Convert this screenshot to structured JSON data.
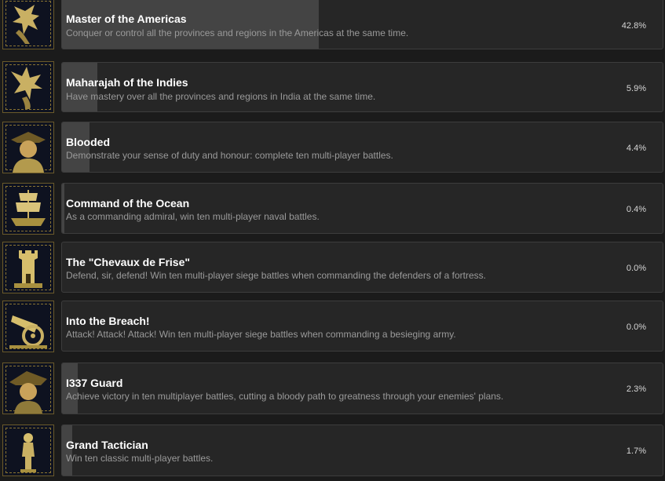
{
  "achievements": [
    {
      "title": "Master of the Americas",
      "description": "Conquer or control all the provinces and regions in the Americas at the same time.",
      "percent_text": "42.8%",
      "percent": 42.8,
      "icon": "eagle-icon"
    },
    {
      "title": "Maharajah of the Indies",
      "description": "Have mastery over all the provinces and regions in India at the same time.",
      "percent_text": "5.9%",
      "percent": 5.9,
      "icon": "eagle-icon"
    },
    {
      "title": "Blooded",
      "description": "Demonstrate your sense of duty and honour: complete ten multi-player battles.",
      "percent_text": "4.4%",
      "percent": 4.4,
      "icon": "officer-portrait-icon"
    },
    {
      "title": "Command of the Ocean",
      "description": "As a commanding admiral, win ten multi-player naval battles.",
      "percent_text": "0.4%",
      "percent": 0.4,
      "icon": "ship-icon"
    },
    {
      "title": "The \"Chevaux de Frise\"",
      "description": "Defend, sir, defend! Win ten multi-player siege battles when commanding the defenders of a fortress.",
      "percent_text": "0.0%",
      "percent": 0.0,
      "icon": "tower-icon"
    },
    {
      "title": "Into the Breach!",
      "description": "Attack! Attack! Attack! Win ten multi-player siege battles when commanding a besieging army.",
      "percent_text": "0.0%",
      "percent": 0.0,
      "icon": "cannon-icon"
    },
    {
      "title": "I337 Guard",
      "description": "Achieve victory in ten multiplayer battles, cutting a bloody path to greatness through your enemies' plans.",
      "percent_text": "2.3%",
      "percent": 2.3,
      "icon": "officer-portrait-icon"
    },
    {
      "title": "Grand Tactician",
      "description": "Win ten classic multi-player battles.",
      "percent_text": "1.7%",
      "percent": 1.7,
      "icon": "soldier-figure-icon"
    }
  ]
}
